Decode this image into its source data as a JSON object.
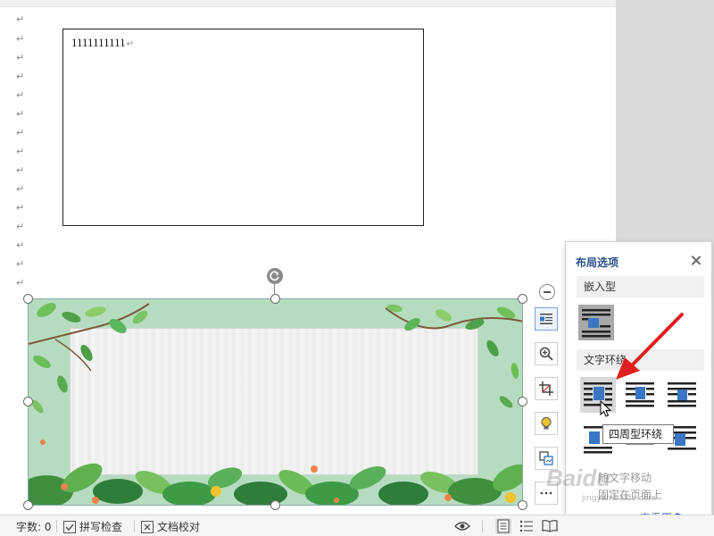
{
  "document": {
    "text_box_content": "1111111111",
    "paragraph_mark": "↵"
  },
  "layout_panel": {
    "title": "布局选项",
    "section_inline": "嵌入型",
    "section_wrap": "文字环绕",
    "move_with_text": "随文字移动",
    "fix_position": "固定在页面上",
    "see_more": "查看更多..."
  },
  "tooltip": {
    "text": "四周型环绕"
  },
  "status_bar": {
    "word_count": "字数: 0",
    "spell_check": "拼写检查",
    "doc_proofread": "文档校对"
  },
  "watermark": {
    "brand": "Baidu",
    "sub": "jingyan.baidu.com"
  },
  "colors": {
    "panel_title": "#2a4f8a",
    "link": "#2a5db0",
    "arrow": "#e02020",
    "picture_bg": "#b6dcc0"
  }
}
